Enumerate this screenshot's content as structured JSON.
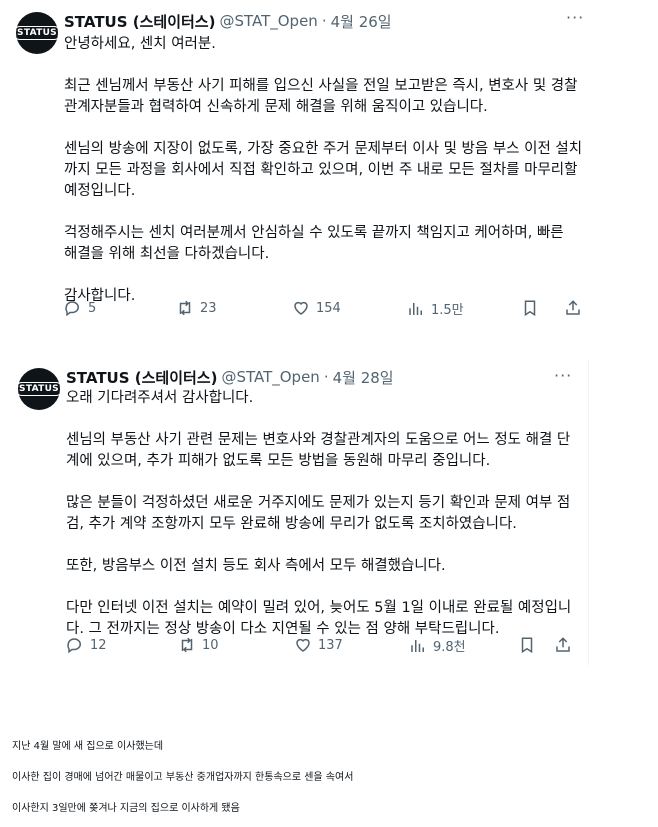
{
  "tweets": [
    {
      "avatar_text": "STATUS",
      "name": "STATUS (스테이터스)",
      "handle": "@STAT_Open",
      "dot": "·",
      "date": "4월 26일",
      "more": "···",
      "body": "안녕하세요, 센치 여러분.\n\n최근 센님께서 부동산 사기 피해를 입으신 사실을 전일 보고받은 즉시, 변호사 및 경찰\n관계자분들과 협력하여 신속하게 문제 해결을 위해 움직이고 있습니다.\n\n센님의 방송에 지장이 없도록, 가장 중요한 주거 문제부터 이사 및 방음 부스 이전 설치\n까지 모든 과정을 회사에서 직접 확인하고 있으며, 이번 주 내로 모든 절차를 마무리할\n예정입니다.\n\n걱정해주시는 센치 여러분께서 안심하실 수 있도록 끝까지 책임지고 케어하며, 빠른\n해결을 위해 최선을 다하겠습니다.\n\n감사합니다.",
      "replies": "5",
      "retweets": "23",
      "likes": "154",
      "views": "1.5만"
    },
    {
      "avatar_text": "STATUS",
      "name": "STATUS (스테이터스)",
      "handle": "@STAT_Open",
      "dot": "·",
      "date": "4월 28일",
      "more": "···",
      "body": "오래 기다려주셔서 감사합니다.\n\n센님의 부동산 사기 관련 문제는 변호사와 경찰관계자의 도움으로 어느 정도 해결 단\n계에 있으며, 추가 피해가 없도록 모든 방법을 동원해 마무리 중입니다.\n\n많은 분들이 걱정하셨던 새로운 거주지에도 문제가 있는지 등기 확인과 문제 여부 점\n검, 추가 계약 조항까지 모두 완료해 방송에 무리가 없도록 조치하였습니다.\n\n또한, 방음부스 이전 설치 등도 회사 측에서 모두 해결했습니다.\n\n다만 인터넷 이전 설치는 예약이 밀려 있어, 늦어도 5월 1일 이내로 완료될 예정입니\n다. 그 전까지는 정상 방송이 다소 지연될 수 있는 점 양해 부탁드립니다.",
      "replies": "12",
      "retweets": "10",
      "likes": "137",
      "views": "9.8천"
    }
  ],
  "bottom_lines": [
    "지난 4월 말에 새 집으로 이사했는데",
    "이사한 집이 경매에 넘어간 매물이고 부동산 중개업자까지 한통속으로 센을 속여서",
    "이사한지 3일만에 쫒겨나 지금의 집으로 이사하게 됐음"
  ]
}
